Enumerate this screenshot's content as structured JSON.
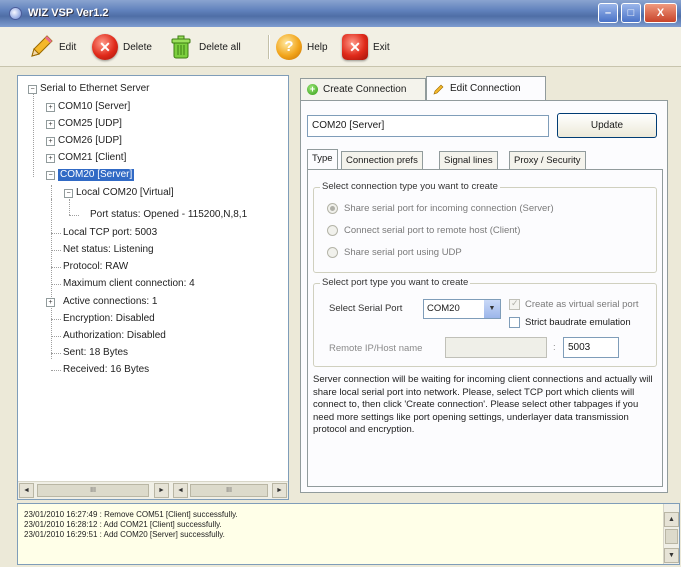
{
  "window": {
    "title": "WIZ VSP Ver1.2",
    "controls": {
      "minimize": "–",
      "maximize": "□",
      "close": "X"
    }
  },
  "toolbar": {
    "edit_label": "Edit",
    "delete_label": "Delete",
    "delete_all_label": "Delete all",
    "help_label": "Help",
    "exit_label": "Exit"
  },
  "tree": {
    "root": "Serial to Ethernet Server",
    "servers": [
      "COM10 [Server]",
      "COM25 [UDP]",
      "COM26 [UDP]",
      "COM21 [Client]",
      "COM20 [Server]"
    ],
    "selected": "COM20 [Server]",
    "local_com": "Local COM20 [Virtual]",
    "port_status": "Port status: Opened - 115200,N,8,1",
    "details": [
      "Local TCP port: 5003",
      "Net status: Listening",
      "Protocol: RAW",
      "Maximum client connection: 4",
      "Active connections: 1",
      "Encryption: Disabled",
      "Authorization: Disabled",
      "Sent: 18 Bytes",
      "Received: 16 Bytes"
    ],
    "scroll": {
      "left": "◄",
      "right": "►",
      "thumb1": "III",
      "thumb2": "III"
    }
  },
  "main_tabs": {
    "create": "Create Connection",
    "edit": "Edit Connection"
  },
  "connection_name": "COM20 [Server]",
  "update_label": "Update",
  "sub_tabs": [
    "Type",
    "Connection prefs",
    "Signal lines",
    "Proxy / Security"
  ],
  "type_group": {
    "title": "Select connection type you want to create",
    "options": [
      "Share serial port for incoming connection (Server)",
      "Connect serial port to remote host (Client)",
      "Share serial port using UDP"
    ]
  },
  "port_group": {
    "title": "Select port type you want to create",
    "serial_port_label": "Select Serial Port",
    "serial_port_value": "COM20",
    "virtual_label": "Create as virtual serial port",
    "strict_label": "Strict baudrate emulation",
    "remote_label": "Remote IP/Host name",
    "port_sep": ":",
    "port_value": "5003"
  },
  "description": "Server connection will be waiting for incoming client connections and actually will share local serial port into network. Please, select TCP port which clients will connect to, then click 'Create connection'. Please select other tabpages if you need more settings like port opening settings, underlayer data transmission protocol and encryption.",
  "log": {
    "lines": [
      "23/01/2010 16:27:49 : Remove COM51 [Client] successfully.",
      "23/01/2010 16:28:12 : Add COM21 [Client] successfully.",
      "23/01/2010 16:29:51 : Add COM20 [Server] successfully."
    ],
    "scroll_up": "▲",
    "scroll_down": "▼"
  },
  "expanders": {
    "collapsed": "+",
    "expanded": "−"
  },
  "select_arrow": "▼",
  "colors": {
    "selection": "#316ac5",
    "log_background": "#ffffe8",
    "title_bar": "#5f80bb"
  }
}
